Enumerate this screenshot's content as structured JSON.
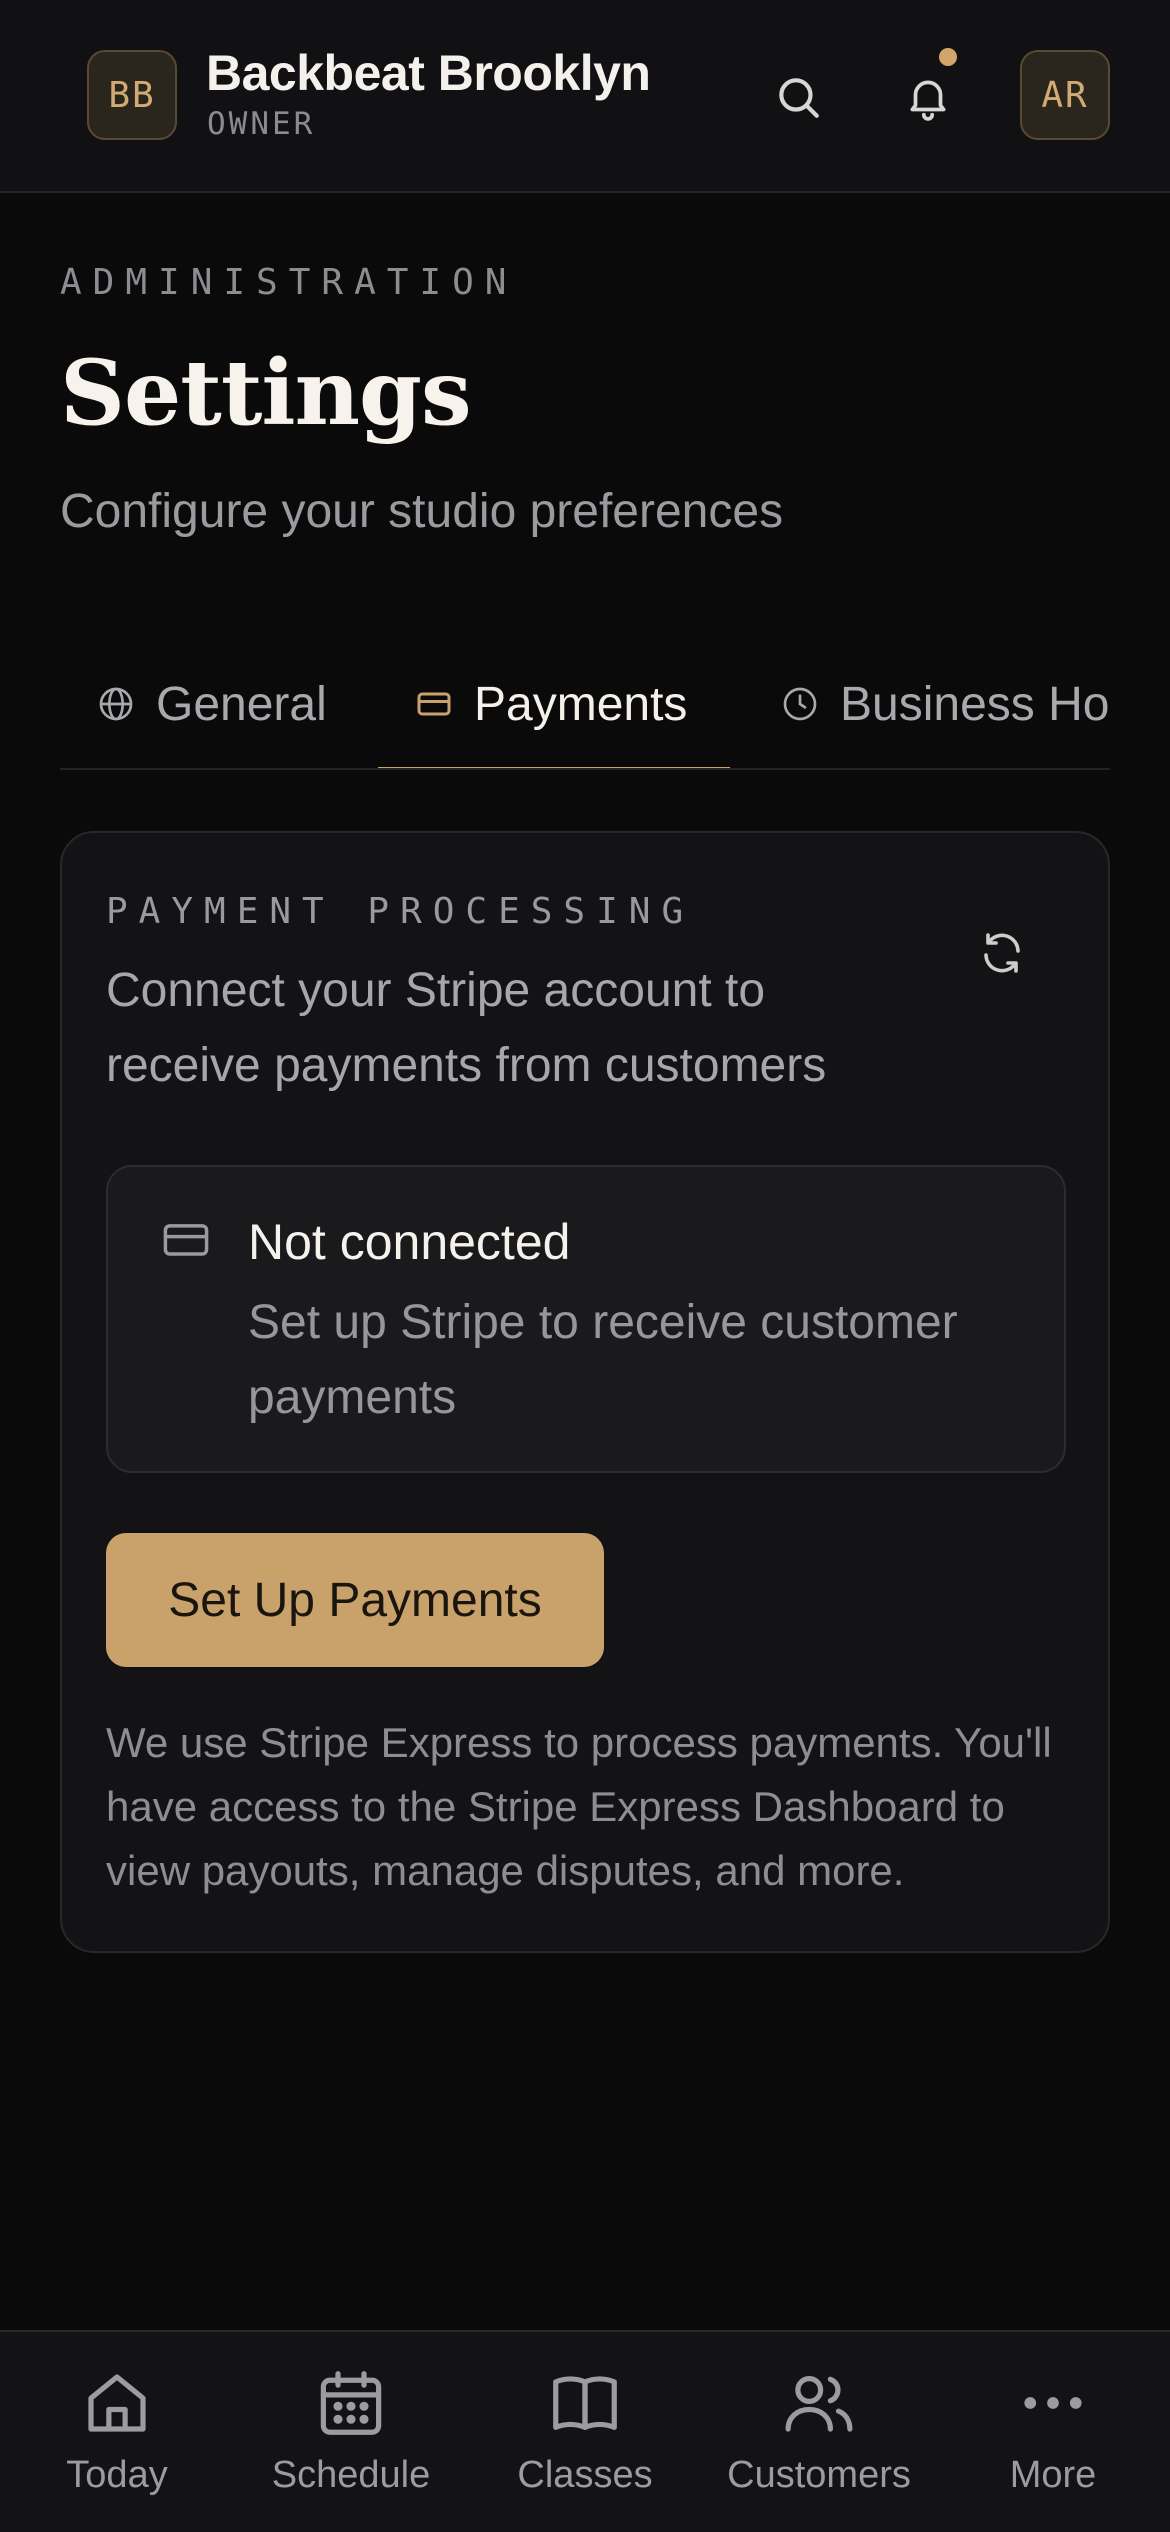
{
  "header": {
    "studio_initials": "BB",
    "studio_name": "Backbeat Brooklyn",
    "role": "OWNER",
    "user_initials": "AR",
    "has_notification": true
  },
  "page": {
    "eyebrow": "ADMINISTRATION",
    "title": "Settings",
    "subtitle": "Configure your studio preferences"
  },
  "tabs": [
    {
      "label": "General",
      "icon": "globe-icon",
      "active": false
    },
    {
      "label": "Payments",
      "icon": "credit-card-icon",
      "active": true
    },
    {
      "label": "Business Ho",
      "icon": "clock-icon",
      "active": false
    }
  ],
  "payments": {
    "section_label": "PAYMENT PROCESSING",
    "description": "Connect your Stripe account to receive payments from customers",
    "status_title": "Not connected",
    "status_description": "Set up Stripe to receive customer payments",
    "setup_button": "Set Up Payments",
    "note": "We use Stripe Express to process payments. You'll have access to the Stripe Express Dashboard to view payouts, manage disputes, and more."
  },
  "bottom_nav": [
    {
      "label": "Today",
      "icon": "home-icon"
    },
    {
      "label": "Schedule",
      "icon": "calendar-icon"
    },
    {
      "label": "Classes",
      "icon": "book-icon"
    },
    {
      "label": "Customers",
      "icon": "users-icon"
    },
    {
      "label": "More",
      "icon": "more-icon"
    }
  ],
  "colors": {
    "accent": "#c8a26a",
    "background": "#0a0a0b",
    "card": "#131315"
  }
}
